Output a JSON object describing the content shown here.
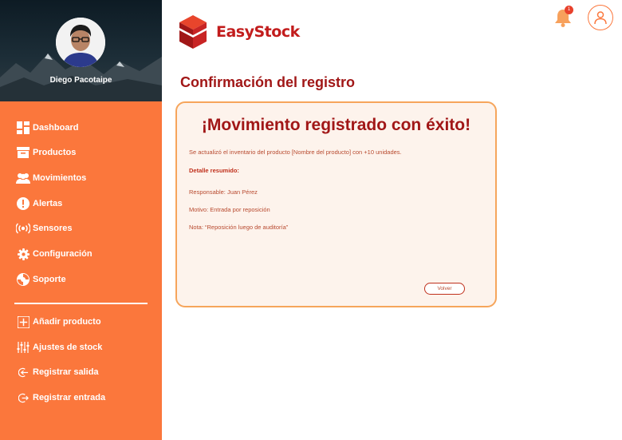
{
  "profile": {
    "name": "Diego Pacotaipe"
  },
  "nav": {
    "items": [
      {
        "label": "Dashboard",
        "icon": "dashboard-icon"
      },
      {
        "label": "Productos",
        "icon": "box-icon"
      },
      {
        "label": "Movimientos",
        "icon": "users-icon"
      },
      {
        "label": "Alertas",
        "icon": "alert-icon"
      },
      {
        "label": "Sensores",
        "icon": "sensor-icon"
      },
      {
        "label": "Configuración",
        "icon": "gear-icon"
      },
      {
        "label": "Soporte",
        "icon": "support-icon"
      }
    ],
    "actions": [
      {
        "label": "Añadir producto",
        "icon": "plus-icon"
      },
      {
        "label": "Ajustes de stock",
        "icon": "sliders-icon"
      },
      {
        "label": "Registrar salida",
        "icon": "exit-icon"
      },
      {
        "label": "Registrar entrada",
        "icon": "enter-icon"
      }
    ]
  },
  "header": {
    "logo_text": "EasyStock",
    "notification_count": "1"
  },
  "page": {
    "title": "Confirmación del registro"
  },
  "card": {
    "title": "¡Movimiento registrado con éxito!",
    "message": "Se actualizó el inventario del producto [Nombre del producto] con +10 unidades.",
    "detail_heading": "Detalle resumido:",
    "responsable": "Responsable: Juan Pérez",
    "motivo": "Motivo: Entrada por reposición",
    "nota": "Nota: “Reposición luego de auditoría”",
    "back_button": "Volver"
  },
  "colors": {
    "sidebar": "#fb773c",
    "brand_red": "#c21c1c",
    "title_red": "#a11717",
    "card_border": "#f6a55b",
    "card_bg": "#fdf3ec"
  }
}
